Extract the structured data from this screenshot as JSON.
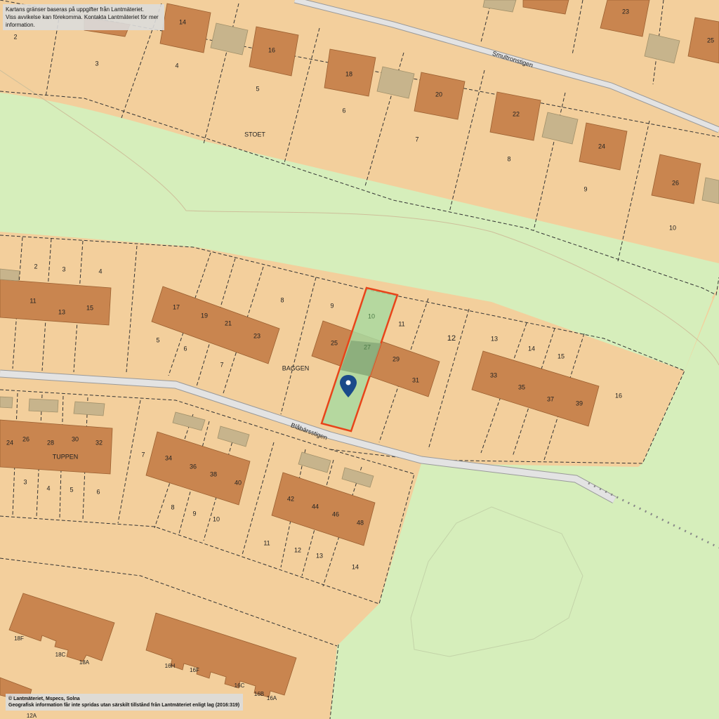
{
  "notice_top": {
    "line1": "Kartans gränser baseras på uppgifter från Lantmäteriet.",
    "line2": "Viss avvikelse kan förekomma. Kontakta Lantmäteriet för mer information."
  },
  "notice_bottom": {
    "line1": "© Lantmäteriet, Mspecs, Solna",
    "line2": "Geografisk information får inte spridas utan särskilt tillstånd från Lantmäteriet enligt lag (2016:319)"
  },
  "streets": {
    "smultronstigen": "Smultronstigen",
    "blabarsstigen": "Blåbärsstigen"
  },
  "blocks": {
    "stoet": "STOET",
    "baggen": "BAGGEN",
    "tuppen": "TUPPEN"
  },
  "selected_parcel": {
    "parcel": "10",
    "house": "27"
  },
  "marker": {
    "icon": "map-pin-icon",
    "color": "#1a4a8a"
  },
  "colors": {
    "land": "#f3cf9c",
    "park": "#d6eebb",
    "building": "#c9854f",
    "selection_border": "#e8441a",
    "selection_fill": "#a9d9a0"
  },
  "stoet": {
    "parcels": [
      "2",
      "3",
      "4",
      "5",
      "6",
      "7",
      "8",
      "9",
      "10"
    ],
    "houses": [
      "14",
      "16",
      "18",
      "20",
      "22",
      "23",
      "24",
      "25",
      "26"
    ]
  },
  "baggen": {
    "parcels": [
      "2",
      "3",
      "4",
      "5",
      "6",
      "7",
      "8",
      "9",
      "11",
      "12",
      "13",
      "14",
      "15",
      "16"
    ],
    "houses": [
      "11",
      "13",
      "15",
      "17",
      "19",
      "21",
      "23",
      "25",
      "29",
      "31",
      "33",
      "35",
      "37",
      "39"
    ]
  },
  "tuppen": {
    "parcels": [
      "3",
      "4",
      "5",
      "6",
      "7",
      "8",
      "9",
      "10",
      "11",
      "12",
      "13",
      "14"
    ],
    "houses": [
      "24",
      "26",
      "28",
      "30",
      "32",
      "34",
      "36",
      "38",
      "40",
      "42",
      "44",
      "46",
      "48"
    ]
  },
  "south": {
    "labels": [
      "18F",
      "18C",
      "18A",
      "16H",
      "16F",
      "16C",
      "16B",
      "16A",
      "12A"
    ]
  }
}
